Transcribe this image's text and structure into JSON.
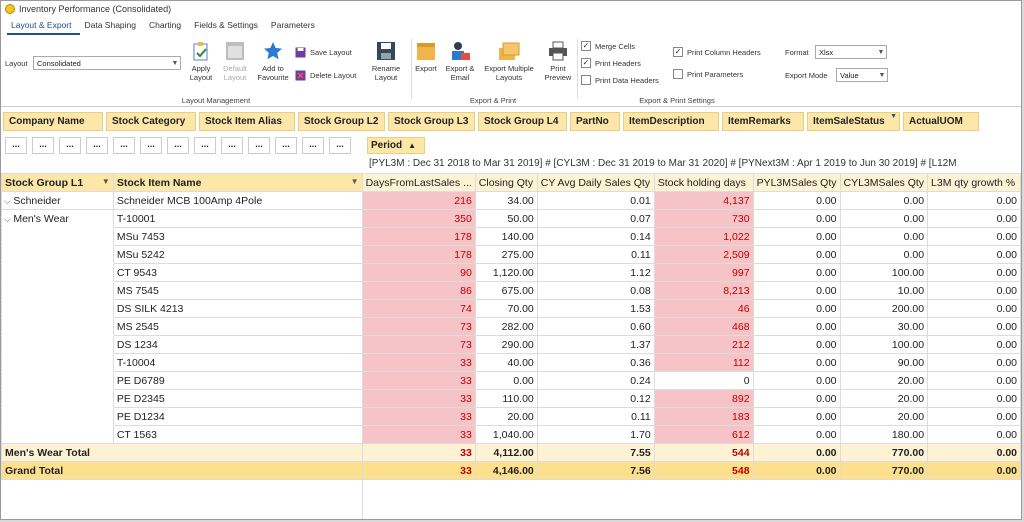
{
  "window": {
    "title": "Inventory Performance (Consolidated)"
  },
  "tabs": [
    "Layout & Export",
    "Data Shaping",
    "Charting",
    "Fields & Settings",
    "Parameters"
  ],
  "ribbon": {
    "layout_label": "Layout",
    "layout_value": "Consolidated",
    "apply_layout": "Apply Layout",
    "default_layout": "Default Layout",
    "add_favourite": "Add to Favourite",
    "save_layout": "Save Layout",
    "delete_layout": "Delete Layout",
    "rename_layout": "Rename Layout",
    "group_layout": "Layout Management",
    "export": "Export",
    "export_email": "Export & Email",
    "export_multiple": "Export Multiple Layouts",
    "print_preview": "Print Preview",
    "group_export": "Export & Print",
    "merge_cells": "Merge Cells",
    "print_headers": "Print Headers",
    "print_data_headers": "Print Data Headers",
    "print_column_headers": "Print Column Headers",
    "print_parameters": "Print Parameters",
    "format_label": "Format",
    "format_value": "Xlsx",
    "export_mode_label": "Export Mode",
    "export_mode_value": "Value",
    "group_settings": "Export & Print Settings"
  },
  "field_chips": [
    "Company Name",
    "Stock Category",
    "Stock Item Alias",
    "Stock Group L2",
    "Stock Group L3",
    "Stock Group L4",
    "PartNo",
    "ItemDescription",
    "ItemRemarks",
    "ItemSaleStatus",
    "ActualUOM"
  ],
  "filter_dots": "...",
  "period": {
    "label": "Period",
    "line": "[PYL3M : Dec 31 2018 to Mar 31 2019]   #  [CYL3M : Dec 31 2019 to Mar 31 2020]   #  [PYNext3M : Apr  1 2019 to Jun 30 2019]   #  [L12M"
  },
  "grid": {
    "row_headers": [
      "Stock Group L1",
      "Stock Item Name"
    ],
    "columns": [
      "DaysFromLastSales ...",
      "Closing Qty",
      "CY Avg Daily Sales Qty",
      "Stock holding days",
      "PYL3MSales Qty",
      "CYL3MSales Qty",
      "L3M qty growth %"
    ],
    "rows": [
      {
        "group": "Schneider",
        "item": "Schneider MCB 100Amp 4Pole",
        "v": [
          "216",
          "34.00",
          "0.01",
          "4,137",
          "0.00",
          "0.00",
          "0.00"
        ]
      },
      {
        "group": "Men's Wear",
        "item": "T-10001",
        "v": [
          "350",
          "50.00",
          "0.07",
          "730",
          "0.00",
          "0.00",
          "0.00"
        ]
      },
      {
        "group": "",
        "item": "MSu 7453",
        "v": [
          "178",
          "140.00",
          "0.14",
          "1,022",
          "0.00",
          "0.00",
          "0.00"
        ]
      },
      {
        "group": "",
        "item": "MSu 5242",
        "v": [
          "178",
          "275.00",
          "0.11",
          "2,509",
          "0.00",
          "0.00",
          "0.00"
        ]
      },
      {
        "group": "",
        "item": "CT 9543",
        "v": [
          "90",
          "1,120.00",
          "1.12",
          "997",
          "0.00",
          "100.00",
          "0.00"
        ]
      },
      {
        "group": "",
        "item": "MS 7545",
        "v": [
          "86",
          "675.00",
          "0.08",
          "8,213",
          "0.00",
          "10.00",
          "0.00"
        ]
      },
      {
        "group": "",
        "item": "DS SILK 4213",
        "v": [
          "74",
          "70.00",
          "1.53",
          "46",
          "0.00",
          "200.00",
          "0.00"
        ]
      },
      {
        "group": "",
        "item": "MS 2545",
        "v": [
          "73",
          "282.00",
          "0.60",
          "468",
          "0.00",
          "30.00",
          "0.00"
        ]
      },
      {
        "group": "",
        "item": "DS 1234",
        "v": [
          "73",
          "290.00",
          "1.37",
          "212",
          "0.00",
          "100.00",
          "0.00"
        ]
      },
      {
        "group": "",
        "item": "T-10004",
        "v": [
          "33",
          "40.00",
          "0.36",
          "112",
          "0.00",
          "90.00",
          "0.00"
        ]
      },
      {
        "group": "",
        "item": "PE D6789",
        "v": [
          "33",
          "0.00",
          "0.24",
          "0",
          "0.00",
          "20.00",
          "0.00"
        ]
      },
      {
        "group": "",
        "item": "PE D2345",
        "v": [
          "33",
          "110.00",
          "0.12",
          "892",
          "0.00",
          "20.00",
          "0.00"
        ]
      },
      {
        "group": "",
        "item": "PE D1234",
        "v": [
          "33",
          "20.00",
          "0.11",
          "183",
          "0.00",
          "20.00",
          "0.00"
        ]
      },
      {
        "group": "",
        "item": "CT 1563",
        "v": [
          "33",
          "1,040.00",
          "1.70",
          "612",
          "0.00",
          "180.00",
          "0.00"
        ]
      }
    ],
    "total_label": "Men's Wear Total",
    "total": [
      "33",
      "4,112.00",
      "7.55",
      "544",
      "0.00",
      "770.00",
      "0.00"
    ],
    "grand_label": "Grand Total",
    "grand": [
      "33",
      "4,146.00",
      "7.56",
      "548",
      "0.00",
      "770.00",
      "0.00"
    ]
  },
  "colors": {
    "header_yellow": "#fde7a8",
    "red_cell": "#f6c3c6",
    "red_text": "#c00000",
    "accent": "#1d4f91"
  }
}
